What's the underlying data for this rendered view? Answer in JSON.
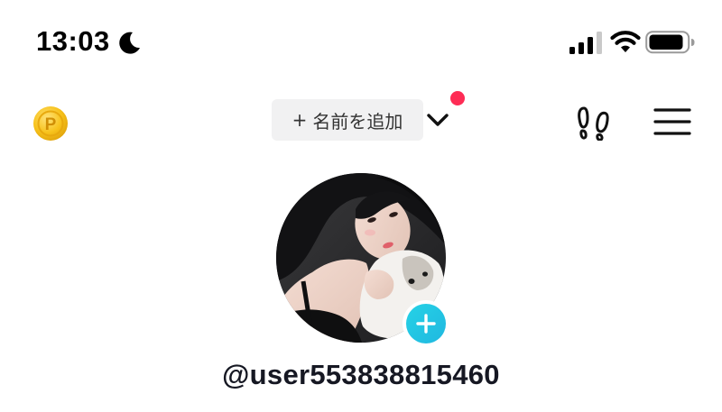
{
  "status_bar": {
    "time": "13:03",
    "focus_mode_icon": "moon-icon",
    "signal_icon": "cellular-signal-icon",
    "wifi_icon": "wifi-icon",
    "battery_icon": "battery-icon"
  },
  "header": {
    "coin_icon": "coin-icon",
    "coin_letter": "P",
    "add_name_plus": "+",
    "add_name_label": "名前を追加",
    "account_switch_icon": "chevron-down-icon",
    "has_notification": true,
    "footprint_icon": "footprint-icon",
    "menu_icon": "hamburger-menu-icon"
  },
  "profile": {
    "avatar_icon": "avatar",
    "add_avatar_icon": "plus-icon",
    "username": "@user553838815460"
  },
  "colors": {
    "notification_dot": "#fe2c55",
    "add_avatar": "#22c6e4",
    "coin": "#f7c21b",
    "pill_background": "#f1f1f2"
  }
}
